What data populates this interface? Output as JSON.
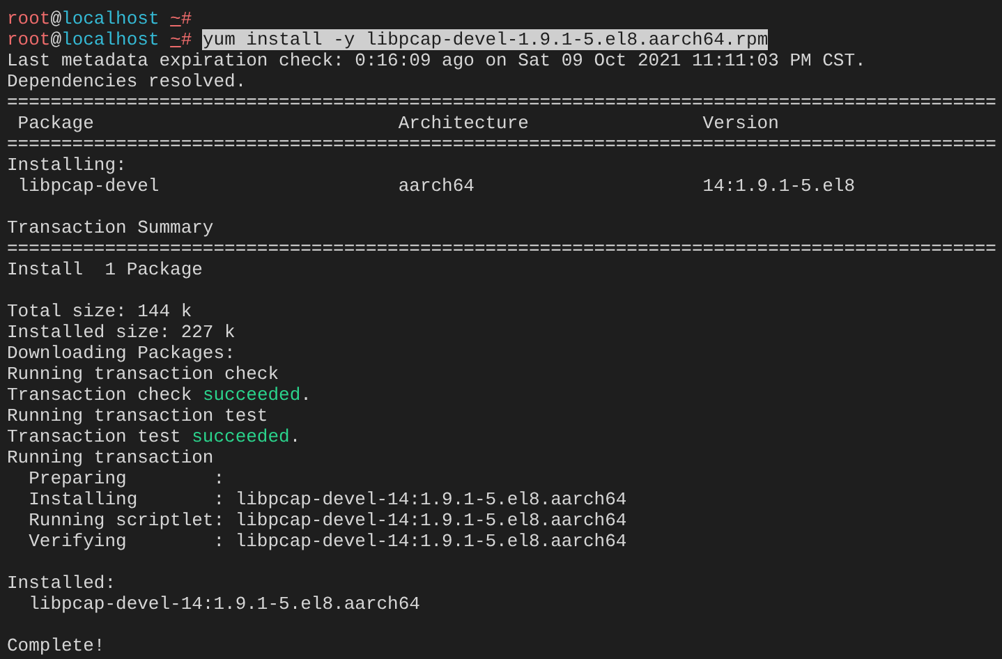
{
  "terminal": {
    "lines": [
      {
        "kind": "partial"
      },
      {
        "kind": "text",
        "segments": [
          {
            "text": "root",
            "kind": "user"
          },
          {
            "text": "@",
            "kind": "plain"
          },
          {
            "text": "localhost ",
            "kind": "host"
          },
          {
            "text": "~",
            "kind": "path"
          },
          {
            "text": "#",
            "kind": "sign"
          }
        ]
      },
      {
        "kind": "text",
        "segments": [
          {
            "text": "root",
            "kind": "user"
          },
          {
            "text": "@",
            "kind": "plain"
          },
          {
            "text": "localhost ",
            "kind": "host"
          },
          {
            "text": "~",
            "kind": "path"
          },
          {
            "text": "# ",
            "kind": "sign"
          },
          {
            "text": "yum install -y libpcap-devel-1.9.1-5.el8.aarch64.rpm",
            "kind": "selected"
          }
        ]
      },
      {
        "kind": "text",
        "segments": [
          {
            "text": "Last metadata expiration check: 0:16:09 ago on Sat 09 Oct 2021 11:11:03 PM CST.",
            "kind": "plain"
          }
        ]
      },
      {
        "kind": "text",
        "segments": [
          {
            "text": "Dependencies resolved.",
            "kind": "plain"
          }
        ]
      },
      {
        "kind": "text",
        "segments": [
          {
            "text": "===========================================================================================",
            "kind": "plain"
          }
        ]
      },
      {
        "kind": "text",
        "segments": [
          {
            "text": " Package                            Architecture                Version",
            "kind": "plain"
          }
        ]
      },
      {
        "kind": "text",
        "segments": [
          {
            "text": "===========================================================================================",
            "kind": "plain"
          }
        ]
      },
      {
        "kind": "text",
        "segments": [
          {
            "text": "Installing:",
            "kind": "plain"
          }
        ]
      },
      {
        "kind": "text",
        "segments": [
          {
            "text": " libpcap-devel                      aarch64                     14:1.9.1-5.el8",
            "kind": "plain"
          }
        ]
      },
      {
        "kind": "blank"
      },
      {
        "kind": "text",
        "segments": [
          {
            "text": "Transaction Summary",
            "kind": "plain"
          }
        ]
      },
      {
        "kind": "text",
        "segments": [
          {
            "text": "===========================================================================================",
            "kind": "plain"
          }
        ]
      },
      {
        "kind": "text",
        "segments": [
          {
            "text": "Install  1 Package",
            "kind": "plain"
          }
        ]
      },
      {
        "kind": "blank"
      },
      {
        "kind": "text",
        "segments": [
          {
            "text": "Total size: 144 k",
            "kind": "plain"
          }
        ]
      },
      {
        "kind": "text",
        "segments": [
          {
            "text": "Installed size: 227 k",
            "kind": "plain"
          }
        ]
      },
      {
        "kind": "text",
        "segments": [
          {
            "text": "Downloading Packages:",
            "kind": "plain"
          }
        ]
      },
      {
        "kind": "text",
        "segments": [
          {
            "text": "Running transaction check",
            "kind": "plain"
          }
        ]
      },
      {
        "kind": "text",
        "segments": [
          {
            "text": "Transaction check ",
            "kind": "plain"
          },
          {
            "text": "succeeded",
            "kind": "success"
          },
          {
            "text": ".",
            "kind": "plain"
          }
        ]
      },
      {
        "kind": "text",
        "segments": [
          {
            "text": "Running transaction test",
            "kind": "plain"
          }
        ]
      },
      {
        "kind": "text",
        "segments": [
          {
            "text": "Transaction test ",
            "kind": "plain"
          },
          {
            "text": "succeeded",
            "kind": "success"
          },
          {
            "text": ".",
            "kind": "plain"
          }
        ]
      },
      {
        "kind": "text",
        "segments": [
          {
            "text": "Running transaction",
            "kind": "plain"
          }
        ]
      },
      {
        "kind": "text",
        "segments": [
          {
            "text": "  Preparing        :",
            "kind": "plain"
          }
        ]
      },
      {
        "kind": "text",
        "segments": [
          {
            "text": "  Installing       : libpcap-devel-14:1.9.1-5.el8.aarch64",
            "kind": "plain"
          }
        ]
      },
      {
        "kind": "text",
        "segments": [
          {
            "text": "  Running scriptlet: libpcap-devel-14:1.9.1-5.el8.aarch64",
            "kind": "plain"
          }
        ]
      },
      {
        "kind": "text",
        "segments": [
          {
            "text": "  Verifying        : libpcap-devel-14:1.9.1-5.el8.aarch64",
            "kind": "plain"
          }
        ]
      },
      {
        "kind": "blank"
      },
      {
        "kind": "text",
        "segments": [
          {
            "text": "Installed:",
            "kind": "plain"
          }
        ]
      },
      {
        "kind": "text",
        "segments": [
          {
            "text": "  libpcap-devel-14:1.9.1-5.el8.aarch64",
            "kind": "plain"
          }
        ]
      },
      {
        "kind": "blank"
      },
      {
        "kind": "text",
        "segments": [
          {
            "text": "Complete!",
            "kind": "plain"
          }
        ]
      }
    ]
  }
}
